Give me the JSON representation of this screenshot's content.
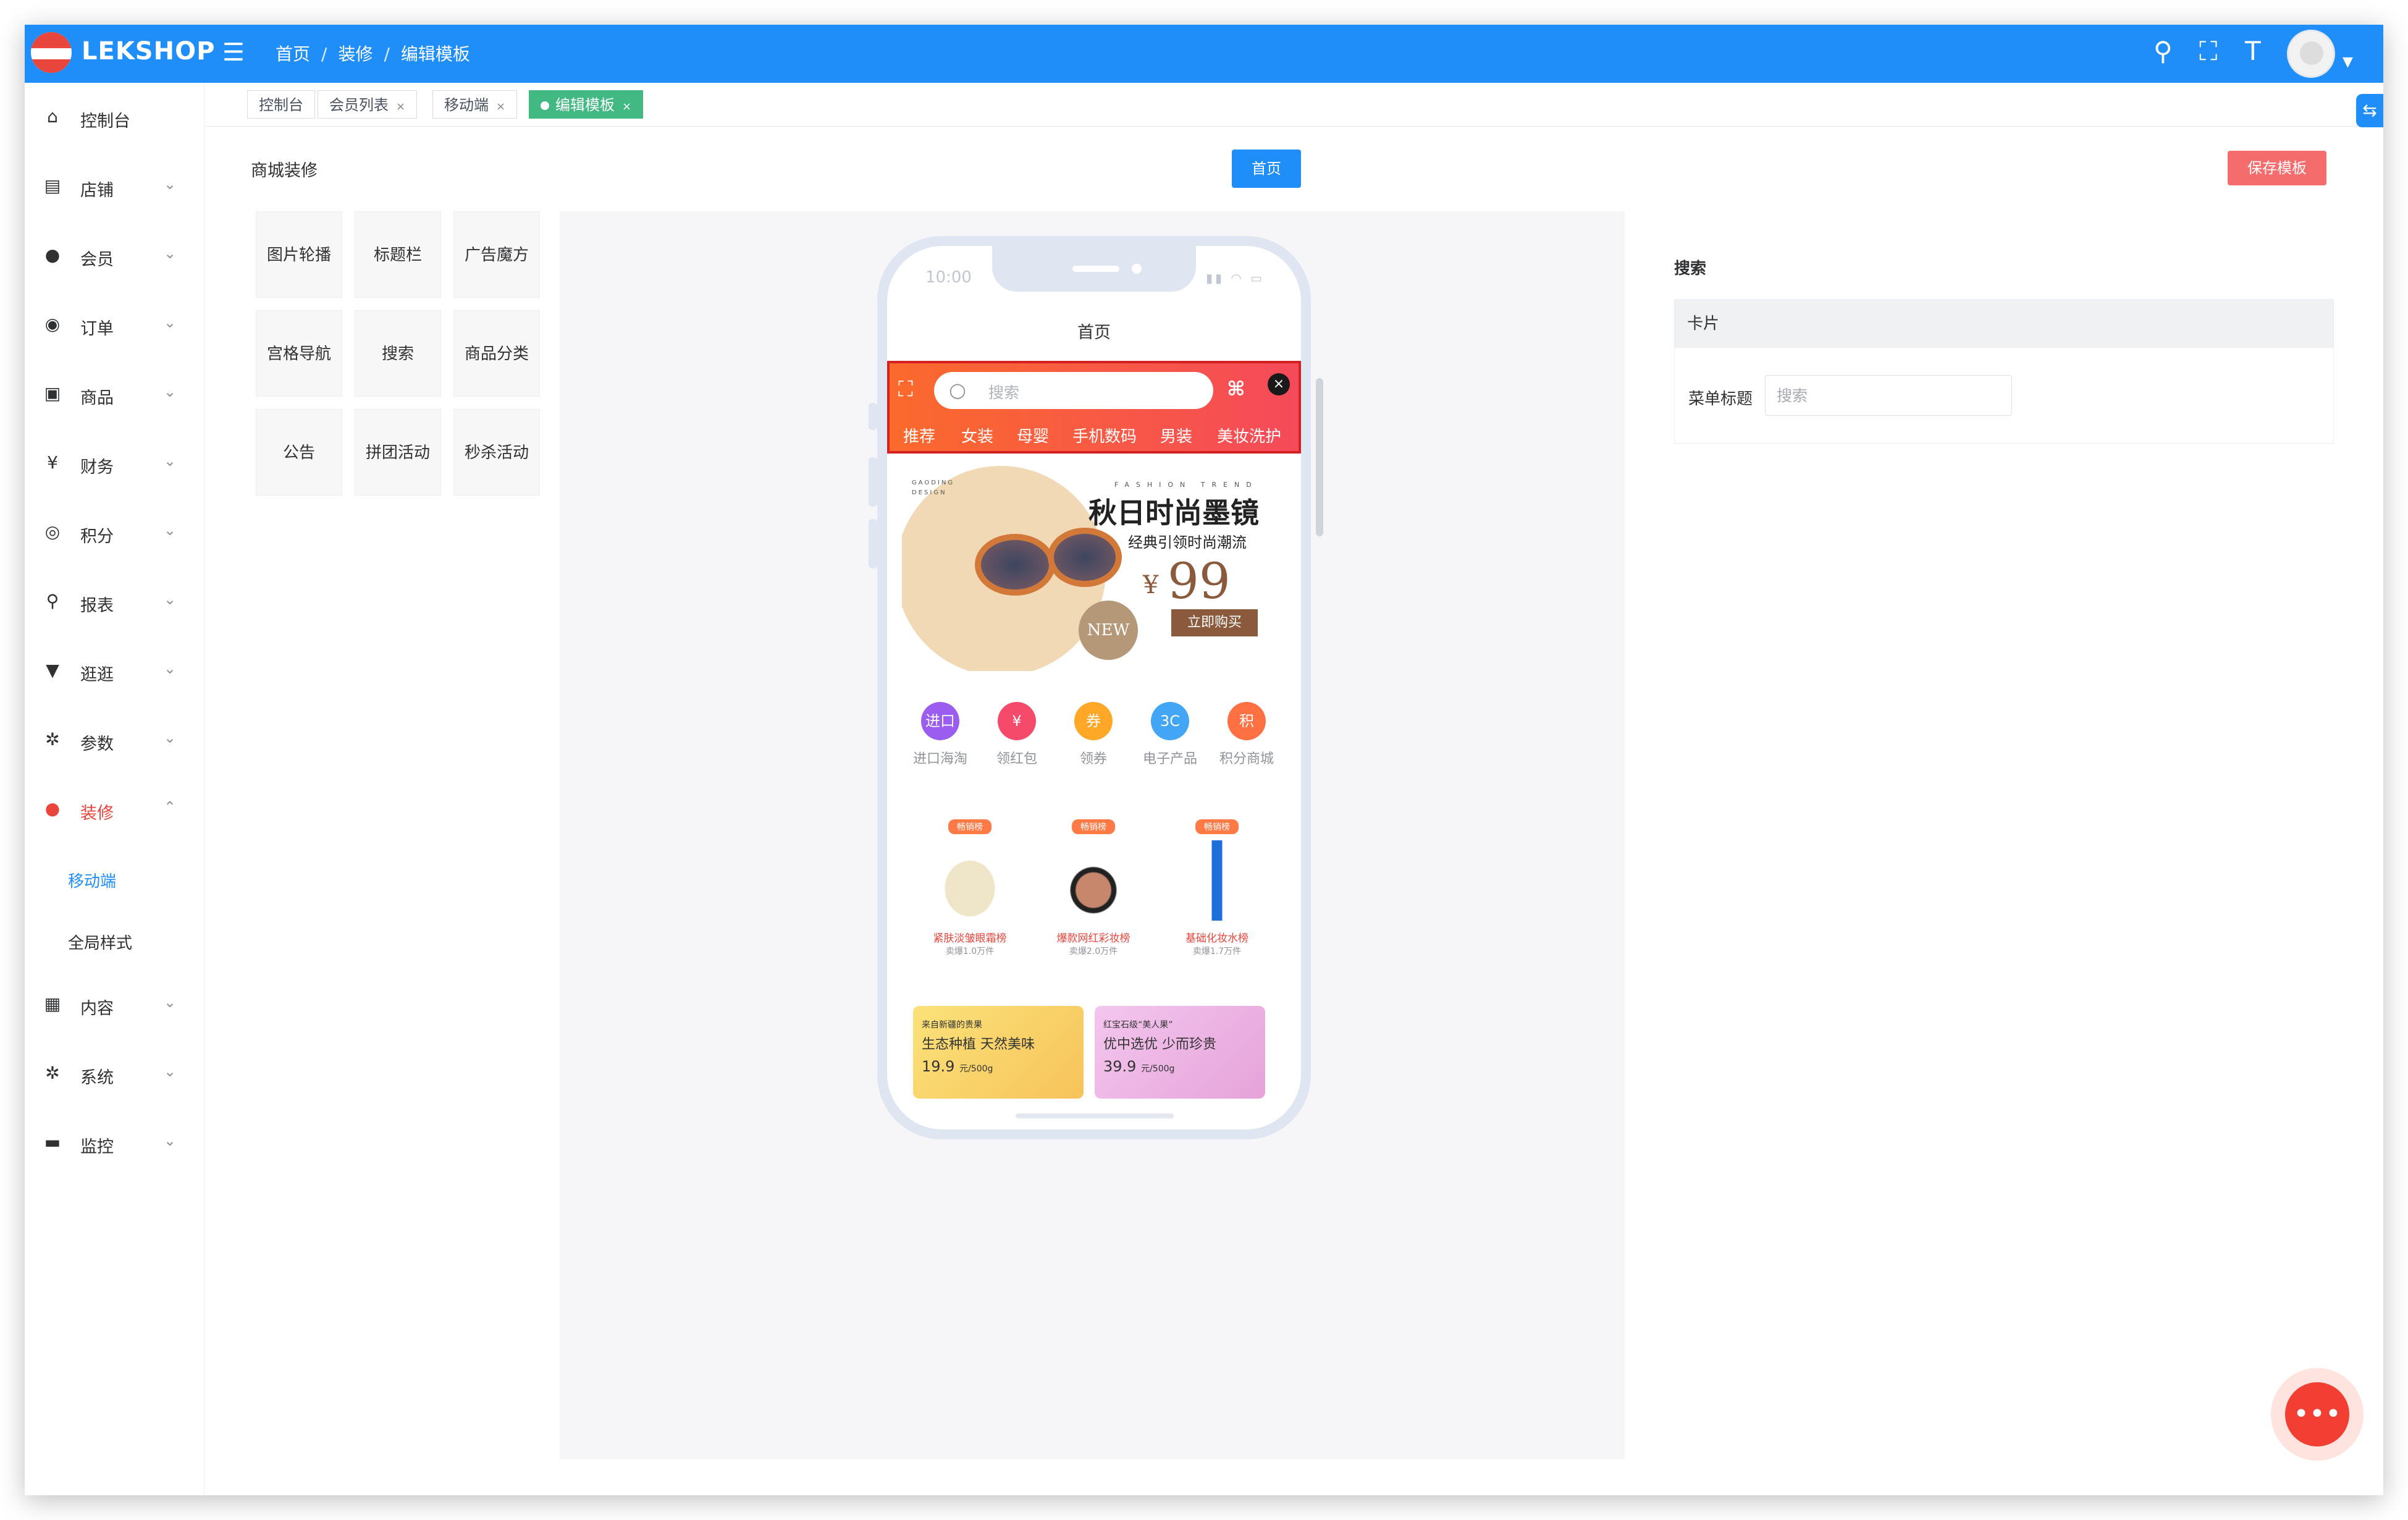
{
  "app": {
    "brand": "LEKSHOP"
  },
  "breadcrumb": [
    "首页",
    "装修",
    "编辑模板"
  ],
  "sidebar": {
    "items": [
      {
        "icon": "home-icon",
        "glyph": "⌂",
        "label": "控制台",
        "chevron": ""
      },
      {
        "icon": "store-icon",
        "glyph": "▤",
        "label": "店铺",
        "chevron": "⌄"
      },
      {
        "icon": "user-icon",
        "glyph": "●",
        "label": "会员",
        "chevron": "⌄"
      },
      {
        "icon": "order-icon",
        "glyph": "◉",
        "label": "订单",
        "chevron": "⌄"
      },
      {
        "icon": "product-icon",
        "glyph": "▣",
        "label": "商品",
        "chevron": "⌄"
      },
      {
        "icon": "yen-icon",
        "glyph": "¥",
        "label": "财务",
        "chevron": "⌄"
      },
      {
        "icon": "points-icon",
        "glyph": "◎",
        "label": "积分",
        "chevron": "⌄"
      },
      {
        "icon": "report-icon",
        "glyph": "⚲",
        "label": "报表",
        "chevron": "⌄"
      },
      {
        "icon": "shirt-icon",
        "glyph": "▼",
        "label": "逛逛",
        "chevron": "⌄"
      },
      {
        "icon": "param-icon",
        "glyph": "✲",
        "label": "参数",
        "chevron": "⌄"
      },
      {
        "icon": "decor-icon",
        "glyph": "●",
        "label": "装修",
        "chevron": "⌃"
      },
      {
        "icon": "content-icon",
        "glyph": "▦",
        "label": "内容",
        "chevron": "⌄"
      },
      {
        "icon": "system-icon",
        "glyph": "✲",
        "label": "系统",
        "chevron": "⌄"
      },
      {
        "icon": "monitor-icon",
        "glyph": "▬",
        "label": "监控",
        "chevron": "⌄"
      }
    ],
    "sub_items": [
      "移动端",
      "全局样式"
    ]
  },
  "tabs": [
    {
      "label": "控制台",
      "close": ""
    },
    {
      "label": "会员列表",
      "close": "×"
    },
    {
      "label": "移动端",
      "close": "×"
    },
    {
      "label": "编辑模板",
      "close": "×"
    }
  ],
  "page": {
    "title": "商城装修",
    "center_button": "首页",
    "save_button": "保存模板"
  },
  "components": [
    "图片轮播",
    "标题栏",
    "广告魔方",
    "宫格导航",
    "搜索",
    "商品分类",
    "公告",
    "拼团活动",
    "秒杀活动"
  ],
  "phone": {
    "time": "10:00",
    "title": "首页",
    "search_placeholder": "搜索",
    "categories": [
      "推荐",
      "女装",
      "母婴",
      "手机数码",
      "男装",
      "美妆洗护"
    ],
    "banner": {
      "design_line1": "GAODING",
      "design_line2": "DESIGN",
      "fashion": "FASHION TREND",
      "title": "秋日时尚墨镜",
      "subtitle": "经典引领时尚潮流",
      "currency": "¥",
      "price": "99",
      "buy": "立即购买",
      "new": "NEW"
    },
    "nav": [
      {
        "label": "进口海淘",
        "glyph": "进口",
        "color": "#9b5cf0"
      },
      {
        "label": "领红包",
        "glyph": "¥",
        "color": "#f54a6a"
      },
      {
        "label": "领券",
        "glyph": "券",
        "color": "#ffa726"
      },
      {
        "label": "电子产品",
        "glyph": "3C",
        "color": "#42a5f5"
      },
      {
        "label": "积分商城",
        "glyph": "积",
        "color": "#ff7043"
      }
    ],
    "products": [
      {
        "tag": "畅销榜",
        "name": "紧肤淡皱眼霜榜",
        "sold": "卖爆1.0万件"
      },
      {
        "tag": "畅销榜",
        "name": "爆款网红彩妆榜",
        "sold": "卖爆2.0万件"
      },
      {
        "tag": "畅销榜",
        "name": "基础化妆水榜",
        "sold": "卖爆1.7万件"
      }
    ],
    "promos": [
      {
        "line1": "来自新疆的贵果",
        "line2": "生态种植 天然美味",
        "price": "19.9",
        "unit": "元/500g"
      },
      {
        "line1": "红宝石级“美人果”",
        "line2": "优中选优 少而珍贵",
        "price": "39.9",
        "unit": "元/500g"
      }
    ]
  },
  "panel": {
    "title": "搜索",
    "card_header": "卡片",
    "field_label": "菜单标题",
    "field_value": "搜索"
  },
  "colors": {
    "primary": "#1f8ef8",
    "danger": "#f56c6c",
    "active_tab": "#42b983",
    "active_menu": "#e8453c"
  }
}
